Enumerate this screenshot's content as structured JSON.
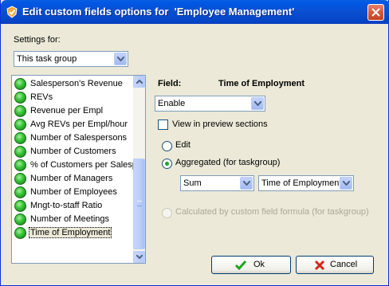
{
  "window": {
    "title": "Edit custom fields options for  'Employee Management'",
    "title_icon": "checkmark-shield-icon",
    "close_icon": "close-icon"
  },
  "settings_for": {
    "label": "Settings for:",
    "selected": "This task group"
  },
  "fields_list": {
    "items": [
      {
        "label": "Salesperson's Revenue"
      },
      {
        "label": "REVs"
      },
      {
        "label": "Revenue per Empl"
      },
      {
        "label": "Avg REVs per Empl/hour"
      },
      {
        "label": "Number of Salespersons"
      },
      {
        "label": "Number of Customers"
      },
      {
        "label": "% of Customers per Salesp"
      },
      {
        "label": "Number of Managers"
      },
      {
        "label": "Number of Employees"
      },
      {
        "label": "Mngt-to-staff Ratio"
      },
      {
        "label": "Number of Meetings"
      },
      {
        "label": "Time of Employment",
        "selected": true
      }
    ],
    "item_icon": "green-status-dot-icon"
  },
  "field_panel": {
    "field_label": "Field:",
    "field_name": "Time of Employment",
    "enable_selected": "Enable",
    "view_preview_label": "View in preview sections",
    "view_preview_checked": false,
    "edit_label": "Edit",
    "aggregated_label": "Aggregated (for taskgroup)",
    "aggregated_checked": true,
    "agg_function": "Sum",
    "agg_field": "Time of Employment",
    "calculated_label": "Calculated by custom field formula (for taskgroup)"
  },
  "buttons": {
    "ok": "Ok",
    "cancel": "Cancel"
  },
  "colors": {
    "title_bar": "#0a4fd0",
    "dialog_bg": "#ece9d8",
    "ok_check": "#21a121",
    "cancel_x": "#d0281b"
  }
}
